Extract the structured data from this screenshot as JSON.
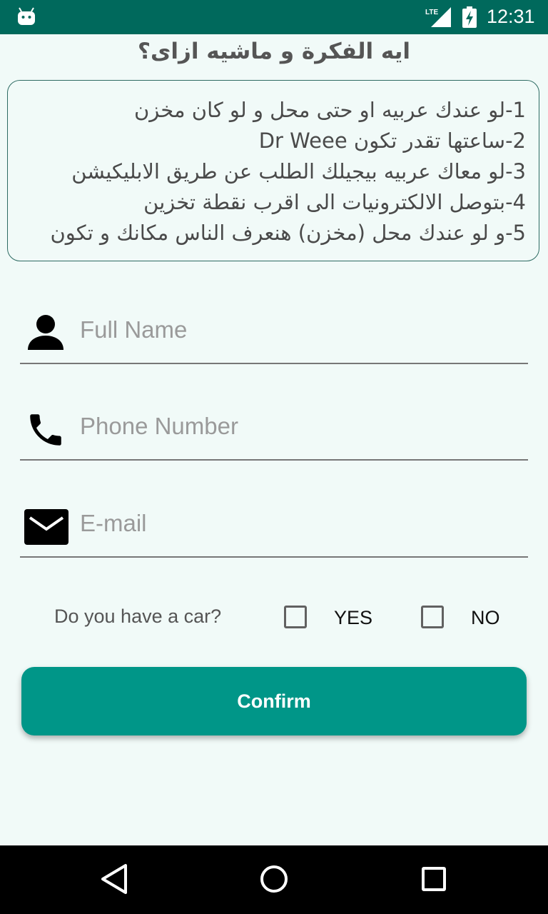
{
  "status_bar": {
    "network": "LTE",
    "time": "12:31",
    "background": "#00695c"
  },
  "header": {
    "title": "ايه الفكرة و ماشيه ازاى؟"
  },
  "info_box": {
    "lines": [
      "1-لو عندك عربيه او حتى محل و لو كان مخزن",
      "2-ساعتها تقدر تكون Dr Weee",
      "3-لو معاك عربيه بيجيلك الطلب عن طريق الابليكيشن",
      "4-بتوصل الالكترونيات الى اقرب نقطة تخزين",
      "5-و لو عندك محل (مخزن) هنعرف الناس مكانك و تكون"
    ]
  },
  "form": {
    "full_name": {
      "placeholder": "Full Name",
      "value": "",
      "icon": "person-icon"
    },
    "phone": {
      "placeholder": "Phone Number",
      "value": "",
      "icon": "phone-icon"
    },
    "email": {
      "placeholder": "E-mail",
      "value": "",
      "icon": "mail-icon"
    },
    "car_question": "Do you have a car?",
    "yes_label": "YES",
    "no_label": "NO",
    "yes_checked": false,
    "no_checked": false
  },
  "confirm_button": {
    "label": "Confirm",
    "color": "#009688"
  },
  "nav_bar": {
    "back_icon": "back-triangle-icon",
    "home_icon": "home-circle-icon",
    "recents_icon": "recents-square-icon"
  }
}
